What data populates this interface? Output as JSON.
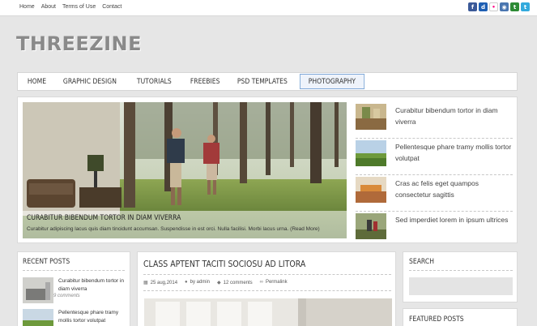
{
  "topnav": [
    "Home",
    "About",
    "Terms of Use",
    "Contact"
  ],
  "social": [
    {
      "icon": "facebook-icon",
      "glyph": "f",
      "color": "#3b5998"
    },
    {
      "icon": "delicious-icon",
      "glyph": "d",
      "color": "#1f5fb3"
    },
    {
      "icon": "flickr-icon",
      "glyph": "•",
      "color": "#ff0084"
    },
    {
      "icon": "rss-icon",
      "glyph": "◉",
      "color": "#4a76b0"
    },
    {
      "icon": "technorati-icon",
      "glyph": "t",
      "color": "#2d8b35"
    },
    {
      "icon": "twitter-icon",
      "glyph": "t",
      "color": "#33aadd"
    }
  ],
  "logo": "THREEZINE",
  "mainnav": [
    "HOME",
    "GRAPHIC DESIGN",
    "TUTORIALS",
    "FREEBIES",
    "PSD TEMPLATES",
    "PHOTOGRAPHY"
  ],
  "slider": {
    "title": "CURABITUR BIBENDUM TORTOR IN DIAM VIVERRA",
    "excerpt": "Curabitur adipiscing lacus quis diam tincidunt accumsan. Suspendisse in est orci. Nulla facilisi. Morbi lacus urna.",
    "more": "(Read More)"
  },
  "sidelist": [
    "Curabitur bibendum tortor in diam viverra",
    "Pellentesque phare tramy mollis tortor volutpat",
    "Cras ac felis eget quampos consectetur sagittis",
    "Sed imperdiet lorem in ipsum ultrices"
  ],
  "recent": {
    "heading": "RECENT POSTS",
    "items": [
      {
        "title": "Curabitur bibendum tortor in diam viverra",
        "comments": "9 comments"
      },
      {
        "title": "Pellentesque phare tramy mollis tortor volutpat",
        "comments": ""
      }
    ]
  },
  "post": {
    "title": "CLASS APTENT TACITI SOCIOSU AD LITORA",
    "date": "25 aug,2014",
    "author": "by admin",
    "comments": "12 comments",
    "permalink": "Permalink"
  },
  "search": {
    "heading": "SEARCH",
    "placeholder": ""
  },
  "featured": {
    "heading": "FEATURED POSTS"
  }
}
